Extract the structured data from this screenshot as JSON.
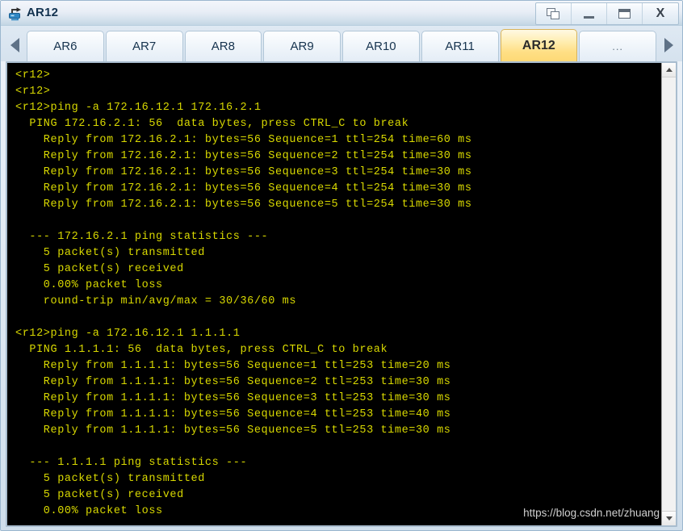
{
  "window": {
    "title": "AR12",
    "icon": "router-icon",
    "controls": [
      {
        "name": "restore-button",
        "icon": "restore-icon",
        "label": ""
      },
      {
        "name": "minimize-button",
        "icon": "minimize-icon",
        "label": ""
      },
      {
        "name": "maximize-button",
        "icon": "maximize-icon",
        "label": ""
      },
      {
        "name": "close-button",
        "icon": "close-icon",
        "label": "X"
      }
    ]
  },
  "tabbar": {
    "scroll_left_icon": "chevron-left-icon",
    "scroll_right_icon": "chevron-right-icon",
    "active_tab": "AR12",
    "tabs": [
      {
        "label": "AR6",
        "active": false
      },
      {
        "label": "AR7",
        "active": false
      },
      {
        "label": "AR8",
        "active": false
      },
      {
        "label": "AR9",
        "active": false
      },
      {
        "label": "AR10",
        "active": false
      },
      {
        "label": "AR11",
        "active": false
      },
      {
        "label": "AR12",
        "active": true
      },
      {
        "label": "...",
        "active": false
      }
    ]
  },
  "terminal": {
    "background_color": "#000000",
    "text_color": "#d9d900",
    "lines": [
      "<r12>",
      "<r12>",
      "<r12>ping -a 172.16.12.1 172.16.2.1",
      "  PING 172.16.2.1: 56  data bytes, press CTRL_C to break",
      "    Reply from 172.16.2.1: bytes=56 Sequence=1 ttl=254 time=60 ms",
      "    Reply from 172.16.2.1: bytes=56 Sequence=2 ttl=254 time=30 ms",
      "    Reply from 172.16.2.1: bytes=56 Sequence=3 ttl=254 time=30 ms",
      "    Reply from 172.16.2.1: bytes=56 Sequence=4 ttl=254 time=30 ms",
      "    Reply from 172.16.2.1: bytes=56 Sequence=5 ttl=254 time=30 ms",
      "",
      "  --- 172.16.2.1 ping statistics ---",
      "    5 packet(s) transmitted",
      "    5 packet(s) received",
      "    0.00% packet loss",
      "    round-trip min/avg/max = 30/36/60 ms",
      "",
      "<r12>ping -a 172.16.12.1 1.1.1.1",
      "  PING 1.1.1.1: 56  data bytes, press CTRL_C to break",
      "    Reply from 1.1.1.1: bytes=56 Sequence=1 ttl=253 time=20 ms",
      "    Reply from 1.1.1.1: bytes=56 Sequence=2 ttl=253 time=30 ms",
      "    Reply from 1.1.1.1: bytes=56 Sequence=3 ttl=253 time=30 ms",
      "    Reply from 1.1.1.1: bytes=56 Sequence=4 ttl=253 time=40 ms",
      "    Reply from 1.1.1.1: bytes=56 Sequence=5 ttl=253 time=30 ms",
      "",
      "  --- 1.1.1.1 ping statistics ---",
      "    5 packet(s) transmitted",
      "    5 packet(s) received",
      "    0.00% packet loss"
    ]
  },
  "scrollbar": {
    "up_icon": "chevron-up-icon",
    "down_icon": "chevron-down-icon"
  },
  "watermark": {
    "text": "https://blog.csdn.net/zhuang"
  }
}
